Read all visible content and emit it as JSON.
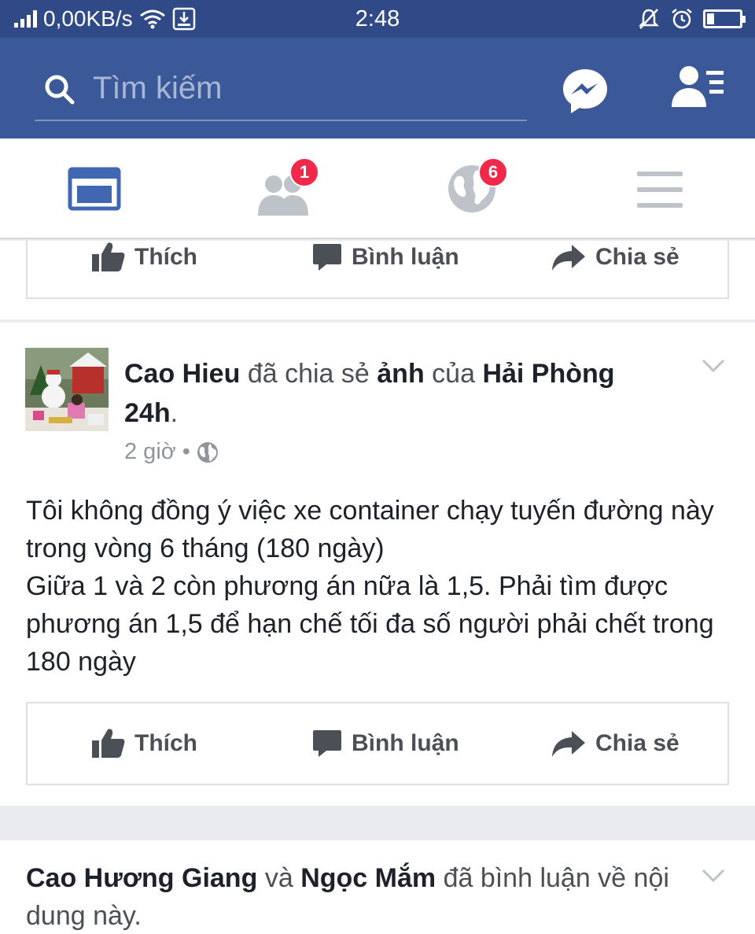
{
  "status_bar": {
    "network_speed": "0,00KB/s",
    "time": "2:48",
    "battery_percent": 22
  },
  "search": {
    "placeholder": "Tìm kiếm"
  },
  "tabs": [
    {
      "name": "news-feed",
      "badge": null,
      "active": true
    },
    {
      "name": "friend-requests",
      "badge": "1",
      "active": false
    },
    {
      "name": "notifications",
      "badge": "6",
      "active": false
    },
    {
      "name": "menu",
      "badge": null,
      "active": false
    }
  ],
  "actions": {
    "like": "Thích",
    "comment": "Bình luận",
    "share": "Chia sẻ"
  },
  "post": {
    "author": "Cao Hieu",
    "verb": "đã chia sẻ",
    "object": "ảnh",
    "of": "của",
    "page": "Hải Phòng 24h",
    "period": ".",
    "time": "2 giờ",
    "separator": "•",
    "text": "Tôi không đồng ý việc xe container chạy tuyến đường này trong vòng 6 tháng (180 ngày)\nGiữa 1 và 2 còn phương án nữa là 1,5. Phải tìm được phương án 1,5 để hạn chế tối đa số người phải chết trong 180 ngày"
  },
  "next_story": {
    "person1": "Cao Hương Giang",
    "and": "và",
    "person2": "Ngọc Mắm",
    "action": "đã bình luận về nội dung này."
  },
  "colors": {
    "brand_blue": "#3b5998",
    "badge_red": "#f02849",
    "feed_background": "#e9ebee"
  }
}
